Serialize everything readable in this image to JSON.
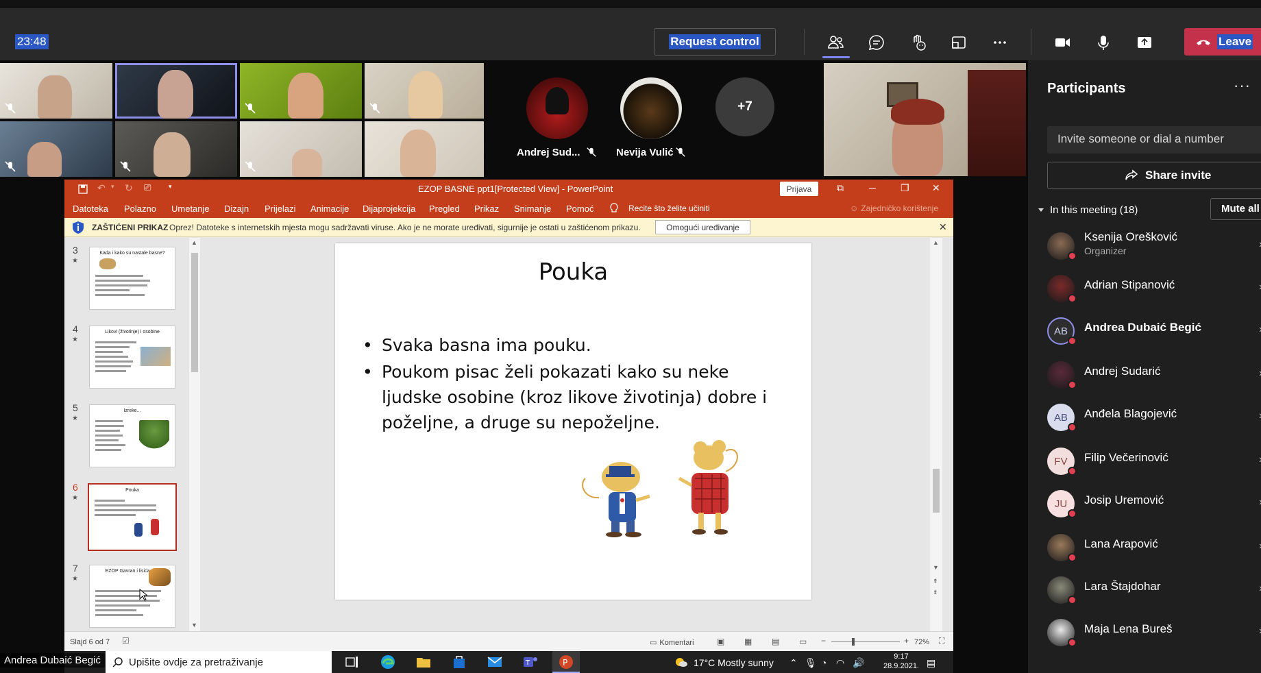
{
  "teams": {
    "clock": "23:48",
    "request_control": "Request control",
    "leave": "Leave",
    "colors": {
      "accent": "#7f85f5",
      "leave": "#c4314b",
      "selection": "#2b57c5"
    }
  },
  "video": {
    "avatars": [
      {
        "name": "Andrej Sud..."
      },
      {
        "name": "Nevija Vulić"
      }
    ],
    "more_count": "+7"
  },
  "participants": {
    "title": "Participants",
    "more": "···",
    "invite_placeholder": "Invite someone or dial a number",
    "share_invite": "Share invite",
    "in_meeting": "In this meeting (18)",
    "mute_all": "Mute all",
    "list": [
      {
        "name": "Ksenija Orešković",
        "role": "Organizer",
        "initials": "",
        "bold": false
      },
      {
        "name": "Adrian Stipanović",
        "role": "",
        "initials": "",
        "bold": false
      },
      {
        "name": "Andrea Dubaić Begić",
        "role": "",
        "initials": "AB",
        "bold": true
      },
      {
        "name": "Andrej Sudarić",
        "role": "",
        "initials": "",
        "bold": false
      },
      {
        "name": "Anđela Blagojević",
        "role": "",
        "initials": "AB",
        "bold": false
      },
      {
        "name": "Filip Večerinović",
        "role": "",
        "initials": "FV",
        "bold": false
      },
      {
        "name": "Josip Uremović",
        "role": "",
        "initials": "JU",
        "bold": false
      },
      {
        "name": "Lana Arapović",
        "role": "",
        "initials": "",
        "bold": false
      },
      {
        "name": "Lara Štajdohar",
        "role": "",
        "initials": "",
        "bold": false
      },
      {
        "name": "Maja Lena Bureš",
        "role": "",
        "initials": "",
        "bold": false
      }
    ]
  },
  "ppt": {
    "doc_title": "EZOP BASNE ppt1[Protected View]  -  PowerPoint",
    "sign_in": "Prijava",
    "tabs": [
      "Datoteka",
      "Polazno",
      "Umetanje",
      "Dizajn",
      "Prijelazi",
      "Animacije",
      "Dijaprojekcija",
      "Pregled",
      "Prikaz",
      "Snimanje",
      "Pomoć"
    ],
    "tell_me": "Recite što želite učiniti",
    "share": "Zajedničko korištenje",
    "protected_title": "ZAŠTIĆENI PRIKAZ",
    "protected_msg": "Oprez! Datoteke s internetskih mjesta mogu sadržavati viruse. Ako je ne morate uređivati, sigurnije je ostati u zaštićenom prikazu.",
    "enable_editing": "Omogući uređivanje",
    "thumbs": [
      {
        "num": "3",
        "title": "Kada i kako su nastale basne?"
      },
      {
        "num": "4",
        "title": "Likovi (životinje) i osobine"
      },
      {
        "num": "5",
        "title": "Izreke..."
      },
      {
        "num": "6",
        "title": "Pouka"
      },
      {
        "num": "7",
        "title": "EZOP Gavran i lisica"
      }
    ],
    "slide": {
      "title": "Pouka",
      "bullets": [
        "Svaka basna ima pouku.",
        "Poukom pisac želi pokazati kako su neke ljudske osobine (kroz likove životinja) dobre i poželjne, a druge su nepoželjne."
      ]
    },
    "status_slide": "Slajd 6 od 7",
    "comments": "Komentari",
    "zoom": "72%"
  },
  "taskbar": {
    "search_placeholder": "Upišite ovdje za pretraživanje",
    "weather": "17°C  Mostly sunny",
    "time": "9:17",
    "date": "28.9.2021."
  },
  "self_name": "Andrea Dubaić Begić"
}
